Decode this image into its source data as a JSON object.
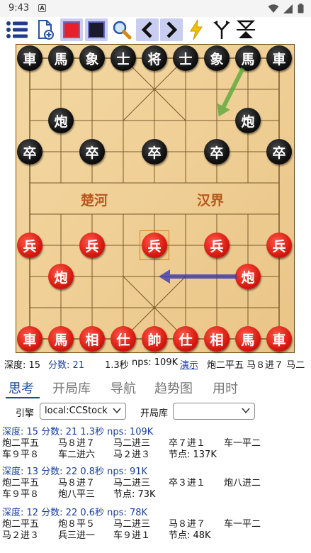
{
  "status_bar": {
    "time": "9:43",
    "notification_glyph": "A",
    "icons": [
      "wifi-icon",
      "signal-icon",
      "battery-icon"
    ]
  },
  "toolbar": {
    "icons": [
      "menu-icon",
      "new-game-icon",
      "red-side-swatch",
      "black-side-swatch",
      "search-icon",
      "back-icon",
      "forward-icon",
      "lightning-icon",
      "branch-icon",
      "flip-icon"
    ],
    "red_color": "#e8202c",
    "black_color": "#1a1a2e",
    "accent_color": "#f2c200"
  },
  "board": {
    "river_left": "楚河",
    "river_right": "汉界",
    "black_pieces": [
      {
        "label": "車",
        "col": 0,
        "row": 0
      },
      {
        "label": "馬",
        "col": 1,
        "row": 0
      },
      {
        "label": "象",
        "col": 2,
        "row": 0
      },
      {
        "label": "士",
        "col": 3,
        "row": 0
      },
      {
        "label": "将",
        "col": 4,
        "row": 0
      },
      {
        "label": "士",
        "col": 5,
        "row": 0
      },
      {
        "label": "象",
        "col": 6,
        "row": 0
      },
      {
        "label": "馬",
        "col": 7,
        "row": 0
      },
      {
        "label": "車",
        "col": 8,
        "row": 0
      },
      {
        "label": "炮",
        "col": 1,
        "row": 2
      },
      {
        "label": "炮",
        "col": 7,
        "row": 2
      },
      {
        "label": "卒",
        "col": 0,
        "row": 3
      },
      {
        "label": "卒",
        "col": 2,
        "row": 3
      },
      {
        "label": "卒",
        "col": 4,
        "row": 3
      },
      {
        "label": "卒",
        "col": 6,
        "row": 3
      },
      {
        "label": "卒",
        "col": 8,
        "row": 3
      }
    ],
    "red_pieces": [
      {
        "label": "兵",
        "col": 0,
        "row": 6
      },
      {
        "label": "兵",
        "col": 2,
        "row": 6
      },
      {
        "label": "兵",
        "col": 4,
        "row": 6
      },
      {
        "label": "兵",
        "col": 6,
        "row": 6
      },
      {
        "label": "兵",
        "col": 8,
        "row": 6
      },
      {
        "label": "炮",
        "col": 1,
        "row": 7
      },
      {
        "label": "炮",
        "col": 7,
        "row": 7
      },
      {
        "label": "車",
        "col": 0,
        "row": 9
      },
      {
        "label": "馬",
        "col": 1,
        "row": 9
      },
      {
        "label": "相",
        "col": 2,
        "row": 9
      },
      {
        "label": "仕",
        "col": 3,
        "row": 9
      },
      {
        "label": "帥",
        "col": 4,
        "row": 9
      },
      {
        "label": "仕",
        "col": 5,
        "row": 9
      },
      {
        "label": "相",
        "col": 6,
        "row": 9
      },
      {
        "label": "馬",
        "col": 7,
        "row": 9
      },
      {
        "label": "車",
        "col": 8,
        "row": 9
      }
    ],
    "highlight": {
      "col": 4,
      "row": 6
    },
    "arrows": [
      {
        "from": {
          "col": 7,
          "row": 0
        },
        "to": {
          "col": 6,
          "row": 2
        },
        "color": "#5aa83a"
      },
      {
        "from": {
          "col": 7,
          "row": 7
        },
        "to": {
          "col": 4,
          "row": 7
        },
        "color": "#3a3ab0"
      }
    ]
  },
  "info_bar": {
    "depth": "深度: 15",
    "score": "分数: 21",
    "time": "1.3秒",
    "nps": "nps: 109K",
    "demo_link": "演示",
    "pv_preview": "炮二平五  马８进７  马二"
  },
  "tabs": [
    "思考",
    "开局库",
    "导航",
    "趋势图",
    "用时"
  ],
  "active_tab": 0,
  "engine_bar": {
    "engine_label": "引擎",
    "engine_value": "local:CCStock",
    "book_label": "开局库",
    "book_value": ""
  },
  "analysis": [
    {
      "head": "深度: 15  分数: 21  1.3秒  nps: 109K",
      "rows": [
        [
          "炮二平五",
          "马８进７",
          "马二进三",
          "卒７进１",
          "车一平二"
        ],
        [
          "车９平８",
          "车二进六",
          "马２进３",
          "节点: 137K",
          ""
        ]
      ]
    },
    {
      "head": "深度: 13  分数: 22  0.8秒  nps: 91K",
      "rows": [
        [
          "炮二平五",
          "马８进７",
          "马二进三",
          "卒３进１",
          "炮八进二"
        ],
        [
          "车９平８",
          "炮八平三",
          "节点: 73K",
          "",
          ""
        ]
      ]
    },
    {
      "head": "深度: 12  分数: 22  0.6秒  nps: 78K",
      "rows": [
        [
          "炮二平五",
          "炮８平５",
          "马二进三",
          "马８进７",
          "车一平二"
        ],
        [
          "马２进３",
          "兵三进一",
          "车９进１",
          "节点: 48K",
          ""
        ]
      ]
    }
  ]
}
